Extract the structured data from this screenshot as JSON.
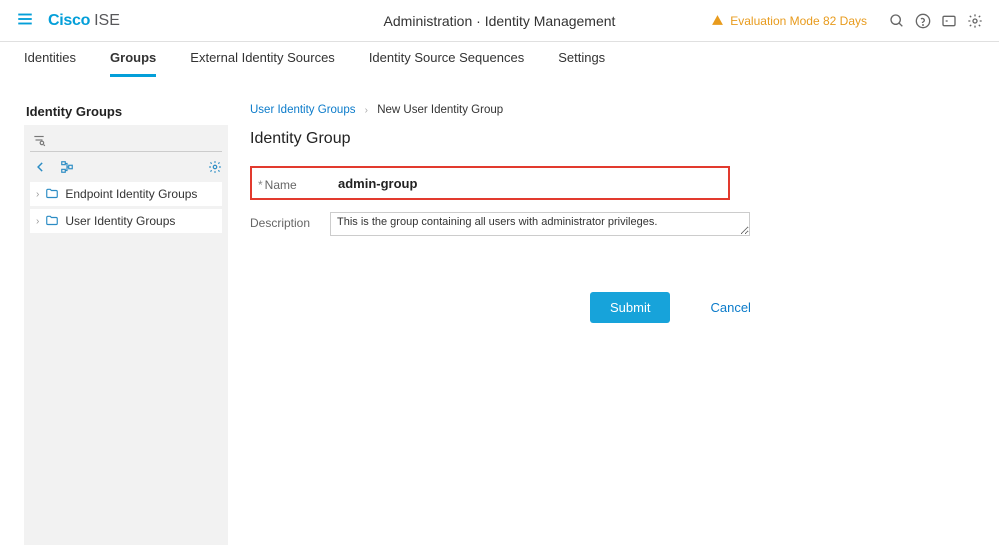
{
  "header": {
    "brand_primary": "Cisco",
    "brand_secondary": "ISE",
    "page_title": "Administration · Identity Management",
    "eval_notice": "Evaluation Mode 82 Days"
  },
  "tabs": {
    "items": [
      {
        "label": "Identities"
      },
      {
        "label": "Groups"
      },
      {
        "label": "External Identity Sources"
      },
      {
        "label": "Identity Source Sequences"
      },
      {
        "label": "Settings"
      }
    ]
  },
  "sidebar": {
    "heading": "Identity Groups",
    "tree": [
      {
        "label": "Endpoint Identity Groups"
      },
      {
        "label": "User Identity Groups"
      }
    ]
  },
  "breadcrumb": {
    "link": "User Identity Groups",
    "current": "New User Identity Group"
  },
  "form": {
    "title": "Identity Group",
    "name_label": "Name",
    "name_value": "admin-group",
    "description_label": "Description",
    "description_value": "This is the group containing all users with administrator privileges."
  },
  "buttons": {
    "submit": "Submit",
    "cancel": "Cancel"
  }
}
